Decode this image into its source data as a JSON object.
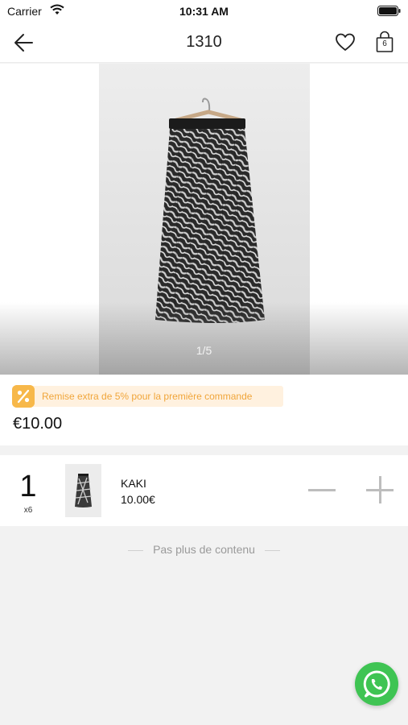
{
  "status_bar": {
    "carrier": "Carrier",
    "time": "10:31 AM"
  },
  "nav": {
    "title": "1310",
    "cart_count": "6"
  },
  "gallery": {
    "counter": "1/5"
  },
  "promo": {
    "text": "Remise extra de 5% pour la première commande",
    "color": "#f0a53a",
    "icon": "percent-tag-icon"
  },
  "price": "€10.00",
  "variant": {
    "quantity": "1",
    "pack": "x6",
    "name": "KAKI",
    "price": "10.00€"
  },
  "footer": {
    "end_text": "Pas plus de contenu"
  },
  "colors": {
    "accent_green": "#3fc453",
    "promo_bg": "#fff1df"
  }
}
